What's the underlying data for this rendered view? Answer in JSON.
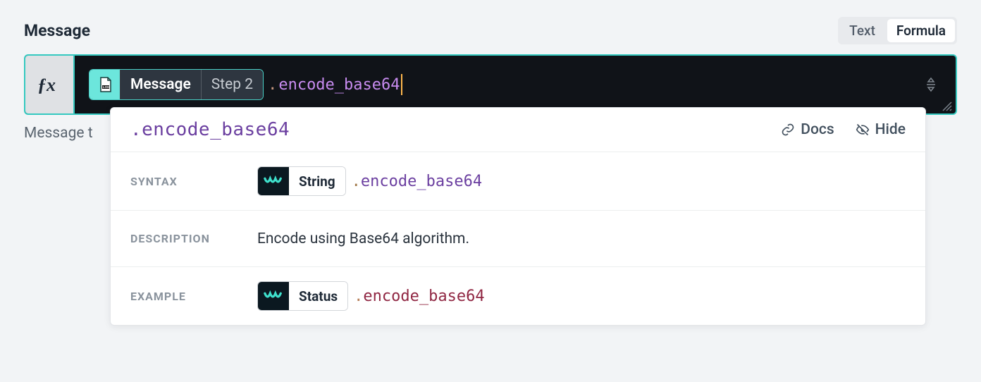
{
  "field": {
    "label": "Message",
    "below_text": "Message t"
  },
  "mode_toggle": {
    "text": "Text",
    "formula": "Formula"
  },
  "editor": {
    "pill_source": "Message",
    "pill_step": "Step 2",
    "method": ".encode_base64"
  },
  "popover": {
    "title": ".encode_base64",
    "docs": "Docs",
    "hide": "Hide",
    "syntax": {
      "label": "SYNTAX",
      "chip": "String",
      "method": ".encode_base64"
    },
    "description": {
      "label": "DESCRIPTION",
      "text": "Encode using Base64 algorithm."
    },
    "example": {
      "label": "EXAMPLE",
      "chip": "Status",
      "method": ".encode_base64"
    }
  }
}
